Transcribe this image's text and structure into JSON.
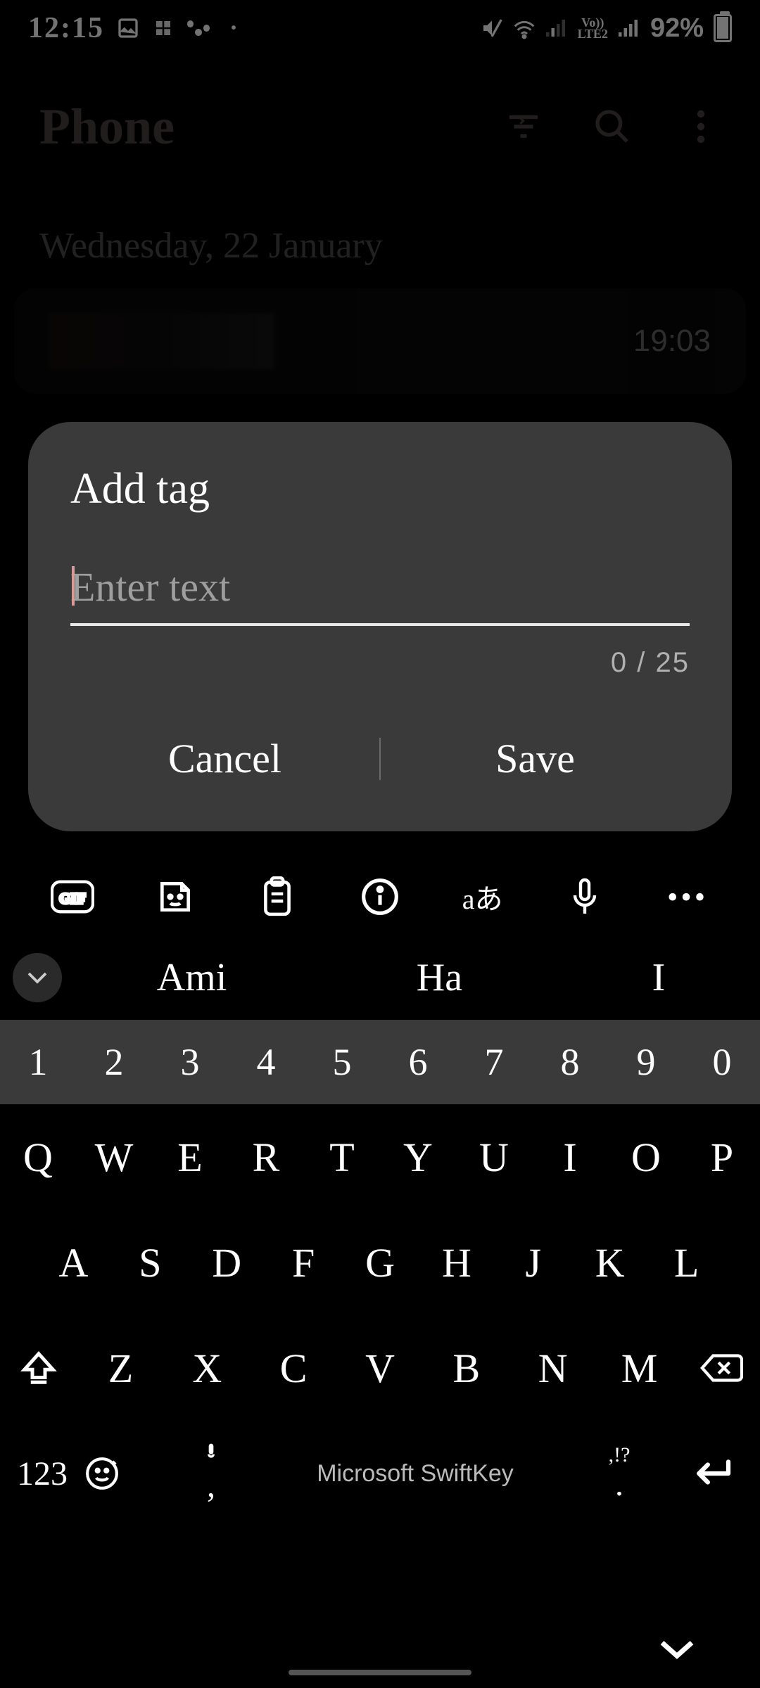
{
  "status": {
    "time": "12:15",
    "lte_label": "Vo))\nLTE2",
    "battery_pct": "92%"
  },
  "header": {
    "title": "Phone"
  },
  "calls": {
    "date_header": "Wednesday, 22 January",
    "items": [
      {
        "time": "19:03"
      }
    ]
  },
  "dialog": {
    "title": "Add tag",
    "placeholder": "Enter text",
    "value": "",
    "char_count": "0 / 25",
    "cancel_label": "Cancel",
    "save_label": "Save"
  },
  "keyboard": {
    "suggestions": [
      "Ami",
      "Ha",
      "I"
    ],
    "numbers": [
      "1",
      "2",
      "3",
      "4",
      "5",
      "6",
      "7",
      "8",
      "9",
      "0"
    ],
    "row1": [
      "Q",
      "W",
      "E",
      "R",
      "T",
      "Y",
      "U",
      "I",
      "O",
      "P"
    ],
    "row2": [
      "A",
      "S",
      "D",
      "F",
      "G",
      "H",
      "J",
      "K",
      "L"
    ],
    "row3": [
      "Z",
      "X",
      "C",
      "V",
      "B",
      "N",
      "M"
    ],
    "fn_label": "123",
    "comma": ",",
    "period": ".",
    "punct_hint": ",!?",
    "brand": "Microsoft SwiftKey"
  }
}
